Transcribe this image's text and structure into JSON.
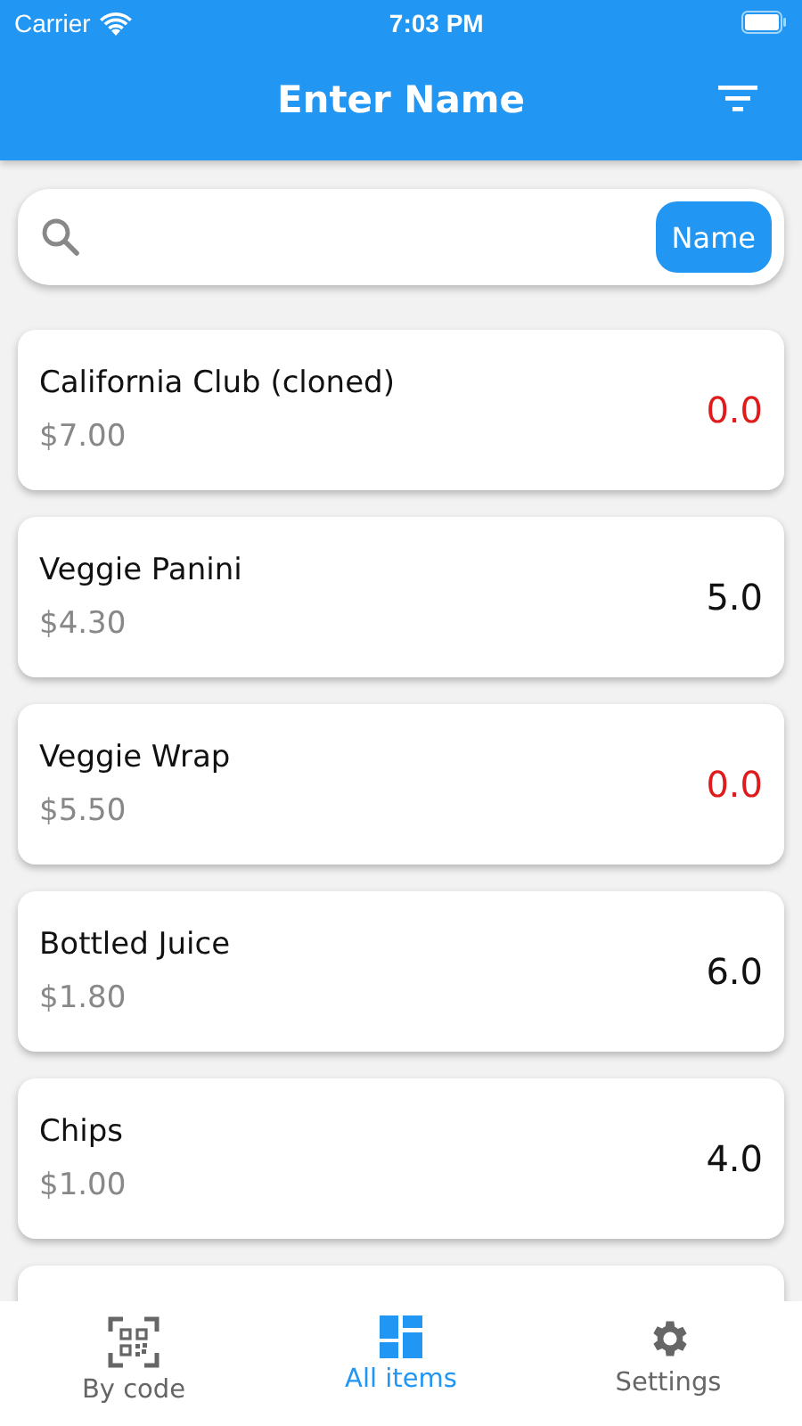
{
  "status_bar": {
    "carrier": "Carrier",
    "time": "7:03 PM"
  },
  "app_bar": {
    "title": "Enter Name"
  },
  "search": {
    "mode_button": "Name"
  },
  "items": [
    {
      "name": "California Club (cloned)",
      "price": "$7.00",
      "quantity": "0.0",
      "alert": true
    },
    {
      "name": "Veggie Panini",
      "price": "$4.30",
      "quantity": "5.0",
      "alert": false
    },
    {
      "name": "Veggie Wrap",
      "price": "$5.50",
      "quantity": "0.0",
      "alert": true
    },
    {
      "name": "Bottled Juice",
      "price": "$1.80",
      "quantity": "6.0",
      "alert": false
    },
    {
      "name": "Chips",
      "price": "$1.00",
      "quantity": "4.0",
      "alert": false
    }
  ],
  "tabs": [
    {
      "label": "By code",
      "kind": "scan",
      "selected": false
    },
    {
      "label": "All items",
      "kind": "list",
      "selected": true
    },
    {
      "label": "Settings",
      "kind": "settings",
      "selected": false
    }
  ]
}
